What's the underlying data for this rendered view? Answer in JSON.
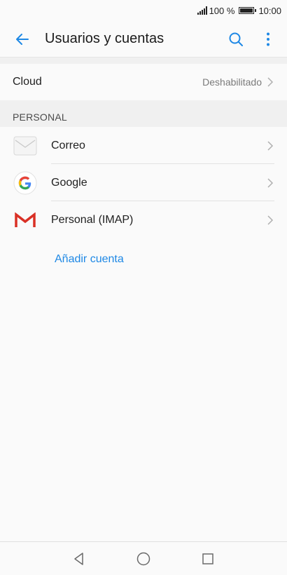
{
  "status_bar": {
    "battery_percent": "100 %",
    "time": "10:00"
  },
  "header": {
    "title": "Usuarios y cuentas",
    "icons": [
      "back-arrow-icon",
      "search-icon",
      "more-vert-icon"
    ]
  },
  "cloud": {
    "label": "Cloud",
    "value": "Deshabilitado"
  },
  "section": {
    "title": "PERSONAL"
  },
  "accounts": [
    {
      "label": "Correo",
      "icon": "email-envelope-icon"
    },
    {
      "label": "Google",
      "icon": "google-g-icon"
    },
    {
      "label": "Personal (IMAP)",
      "icon": "gmail-m-icon"
    }
  ],
  "add_account": {
    "label": "Añadir cuenta"
  },
  "colors": {
    "accent": "#1e88e5",
    "background": "#fafafa",
    "section_background": "#f0f0f0"
  },
  "nav": {
    "icons": [
      "nav-back-icon",
      "nav-home-icon",
      "nav-recents-icon"
    ]
  }
}
